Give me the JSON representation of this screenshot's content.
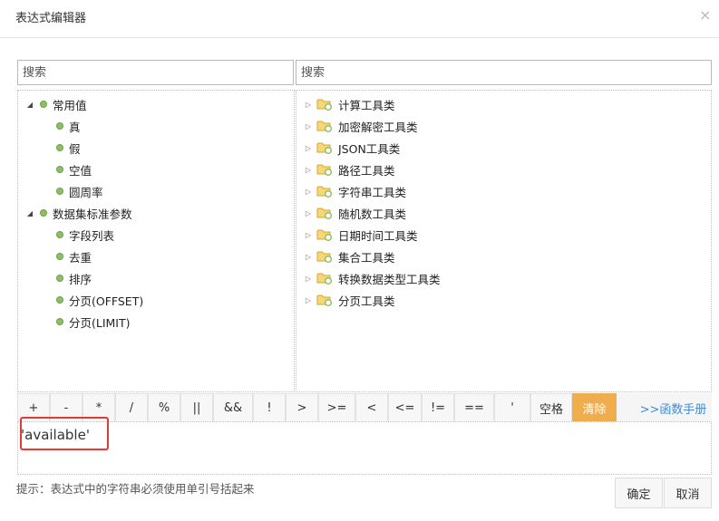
{
  "dialog": {
    "title": "表达式编辑器",
    "close_glyph": "×"
  },
  "search": {
    "left_placeholder": "搜索",
    "right_placeholder": "搜索"
  },
  "left_tree": [
    {
      "label": "常用值",
      "children": [
        "真",
        "假",
        "空值",
        "圆周率"
      ]
    },
    {
      "label": "数据集标准参数",
      "children": [
        "字段列表",
        "去重",
        "排序",
        "分页(OFFSET)",
        "分页(LIMIT)"
      ]
    }
  ],
  "right_tree": [
    "计算工具类",
    "加密解密工具类",
    "JSON工具类",
    "路径工具类",
    "字符串工具类",
    "随机数工具类",
    "日期时间工具类",
    "集合工具类",
    "转换数据类型工具类",
    "分页工具类"
  ],
  "operators": [
    "+",
    "-",
    "*",
    "/",
    "%",
    "||",
    "&&",
    "!",
    ">",
    ">=",
    "<",
    "<=",
    "!=",
    "==",
    "'",
    "空格"
  ],
  "clear_label": "清除",
  "manual_label": ">>函数手册",
  "expression": "'available'",
  "hint": "提示：表达式中的字符串必须使用单引号括起来",
  "buttons": {
    "ok": "确定",
    "cancel": "取消"
  },
  "colors": {
    "accent_orange": "#f0ad4e",
    "link_blue": "#3c8dd8",
    "highlight_red": "#e53935",
    "node_green": "#8dc063",
    "folder_yellow": "#f7d774"
  }
}
